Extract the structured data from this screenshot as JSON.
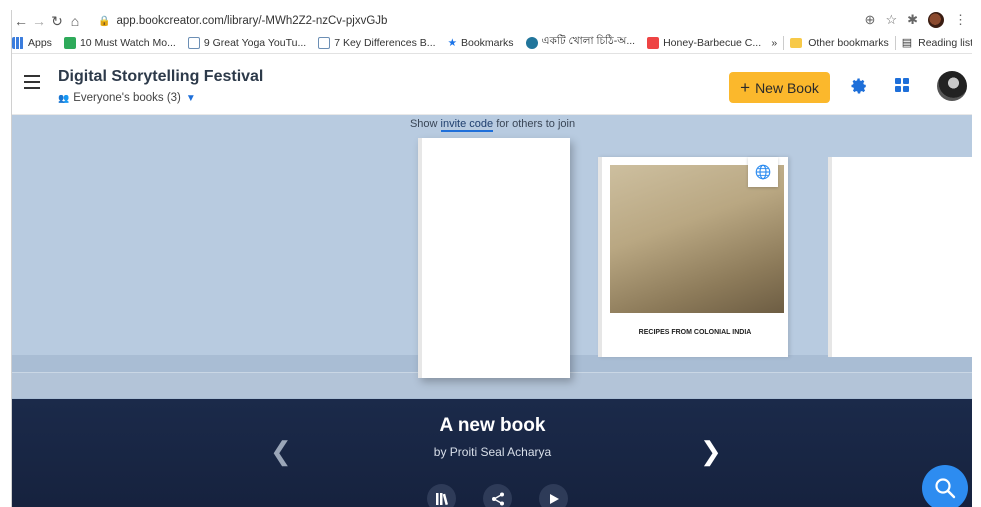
{
  "browser": {
    "url": "app.bookcreator.com/library/-MWh2Z2-nzCv-pjxvGJb",
    "bookmarks": [
      {
        "label": "Apps",
        "icon": "apps-grid-icon",
        "color": "#3b7ddd"
      },
      {
        "label": "10 Must Watch Mo...",
        "icon": "bookmark-green-icon",
        "color": "#2eaa5a"
      },
      {
        "label": "9 Great Yoga YouTu...",
        "icon": "bookmark-h-icon",
        "color": "#6c8fb5"
      },
      {
        "label": "7 Key Differences B...",
        "icon": "bookmark-h-icon",
        "color": "#6c8fb5"
      },
      {
        "label": "Bookmarks",
        "icon": "star-icon",
        "color": "#1a73e8"
      },
      {
        "label": "একটি খোলা চিঠি-অ...",
        "icon": "wordpress-icon",
        "color": "#21759b"
      },
      {
        "label": "Honey-Barbecue C...",
        "icon": "recipe-icon",
        "color": "#e44"
      }
    ],
    "other_bookmarks": "Other bookmarks",
    "reading_list": "Reading list",
    "overflow": "»"
  },
  "header": {
    "title": "Digital Storytelling Festival",
    "subtitle": "Everyone's books (3)",
    "new_book_label": "New Book",
    "accent": "#fbb82c",
    "icon_color": "#1e6fd9"
  },
  "shelf": {
    "invite_prefix": "Show",
    "invite_link": "invite code",
    "invite_suffix": "for others to join",
    "books": [
      {
        "title": ""
      },
      {
        "title": "RECIPES FROM COLONIAL INDIA"
      },
      {
        "title": ""
      }
    ]
  },
  "selected_book": {
    "title": "A new book",
    "author": "by Proiti Seal Acharya"
  },
  "colors": {
    "shelf_bg": "#b8cbe0",
    "info_bg": "#1b2a4a",
    "fab": "#2d8cf0"
  }
}
